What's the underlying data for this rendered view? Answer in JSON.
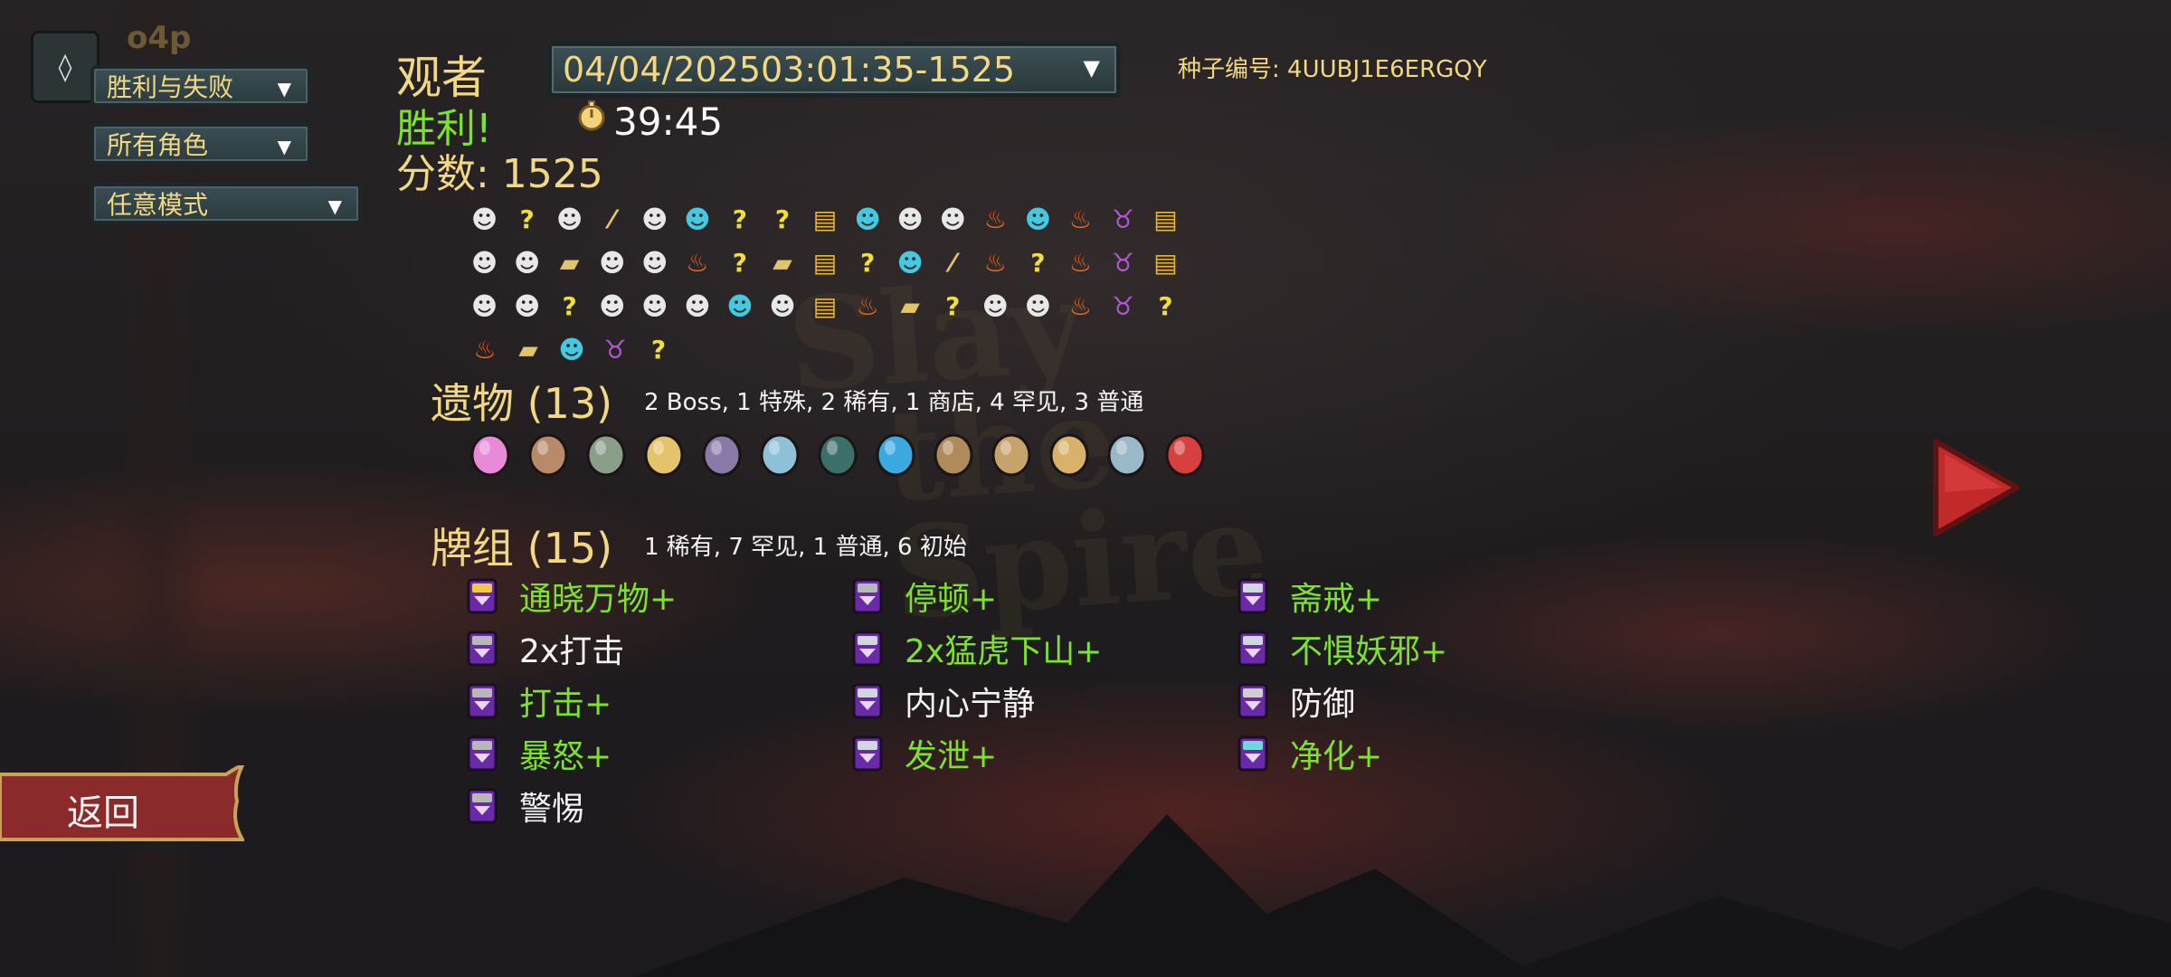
{
  "user_tag": "o4p",
  "filters": {
    "result": "胜利与失败",
    "character": "所有角色",
    "mode": "任意模式"
  },
  "run": {
    "character": "观者",
    "selected_run": "04/04/202503:01:35-1525",
    "result": "胜利!",
    "time": "39:45",
    "score_label": "分数: 1525",
    "seed_label": "种子编号: 4UUBJ1E6ERGQY"
  },
  "map_path": [
    [
      "monster",
      "unknown",
      "monster",
      "treasure-unknown",
      "monster",
      "elite",
      "unknown",
      "unknown-monster",
      "shop",
      "elite",
      "monster",
      "monster",
      "rest",
      "elite",
      "rest",
      "boss",
      "shop"
    ],
    [
      "monster",
      "monster",
      "treasure",
      "monster",
      "monster",
      "rest",
      "unknown-monster",
      "treasure",
      "shop",
      "unknown-monster",
      "elite",
      "treasure-unknown",
      "rest",
      "unknown",
      "rest",
      "boss",
      "shop"
    ],
    [
      "monster",
      "monster",
      "unknown",
      "monster",
      "monster",
      "monster",
      "elite",
      "monster",
      "shop",
      "rest",
      "treasure",
      "unknown",
      "monster",
      "monster",
      "rest",
      "boss",
      "unknown"
    ],
    [
      "rest",
      "treasure",
      "elite",
      "boss",
      "unknown"
    ]
  ],
  "relics": {
    "title": "遗物 (13)",
    "summary": "2 Boss, 1 特殊, 2 稀有, 1 商店, 4 罕见, 3 普通",
    "items": [
      "pure-water-icon",
      "bronze-tablet-icon",
      "ectoplasm-icon",
      "bow-icon",
      "potion-belt-icon",
      "feather-icon",
      "bowl-icon",
      "blue-ink-icon",
      "pack-icon",
      "altar-icon",
      "pyramid-icon",
      "shovel-icon",
      "strawberry-icon"
    ]
  },
  "deck": {
    "title": "牌组 (15)",
    "summary": "1 稀有, 7 罕见, 1 普通, 6 初始",
    "cards": [
      {
        "name": "通晓万物+",
        "upgraded": true,
        "rarity": "rare",
        "col": 0,
        "row": 0
      },
      {
        "name": "2x打击",
        "upgraded": false,
        "rarity": "basic",
        "col": 0,
        "row": 1
      },
      {
        "name": "打击+",
        "upgraded": true,
        "rarity": "basic",
        "col": 0,
        "row": 2
      },
      {
        "name": "暴怒+",
        "upgraded": true,
        "rarity": "basic",
        "col": 0,
        "row": 3
      },
      {
        "name": "警惕",
        "upgraded": false,
        "rarity": "basic",
        "col": 0,
        "row": 4
      },
      {
        "name": "停顿+",
        "upgraded": true,
        "rarity": "basic",
        "col": 1,
        "row": 0
      },
      {
        "name": "2x猛虎下山+",
        "upgraded": true,
        "rarity": "uncommon",
        "col": 1,
        "row": 1
      },
      {
        "name": "内心宁静",
        "upgraded": false,
        "rarity": "uncommon",
        "col": 1,
        "row": 2
      },
      {
        "name": "发泄+",
        "upgraded": true,
        "rarity": "uncommon",
        "col": 1,
        "row": 3
      },
      {
        "name": "斋戒+",
        "upgraded": true,
        "rarity": "uncommon",
        "col": 2,
        "row": 0
      },
      {
        "name": "不惧妖邪+",
        "upgraded": true,
        "rarity": "uncommon",
        "col": 2,
        "row": 1
      },
      {
        "name": "防御",
        "upgraded": false,
        "rarity": "common",
        "col": 2,
        "row": 2
      },
      {
        "name": "净化+",
        "upgraded": true,
        "rarity": "special",
        "col": 2,
        "row": 3
      }
    ]
  },
  "buttons": {
    "back": "返回"
  }
}
